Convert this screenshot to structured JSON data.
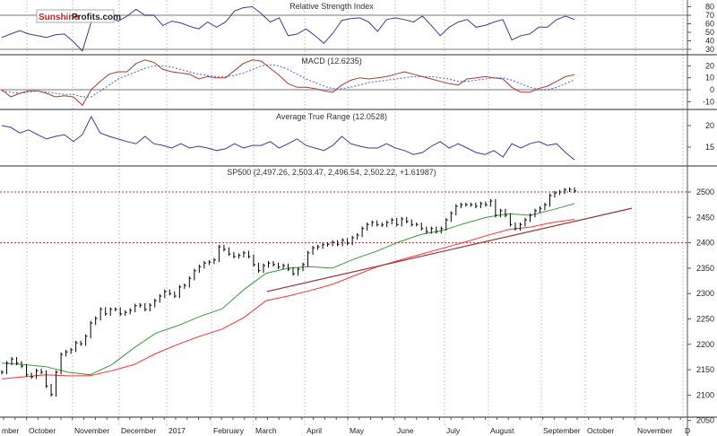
{
  "logo": {
    "part1": "Sunshine",
    "part2": "Profits.com"
  },
  "colors": {
    "rsi": "#3b3b9a",
    "macd": "#b03a2e",
    "signal": "#4a5cff",
    "atr": "#3b3b9a",
    "bars": "#000000",
    "ma_fast": "#3a9a3a",
    "ma_slow": "#ff3030",
    "trendline": "#a03030",
    "level_line": "#c03030"
  },
  "chart_data": [
    {
      "type": "line",
      "title": "Relative Strength Index",
      "ylim": [
        25,
        88
      ],
      "yticks": [
        "80",
        "70",
        "60",
        "50",
        "40",
        "30"
      ],
      "ytick_values": [
        80,
        70,
        60,
        50,
        40,
        30
      ],
      "reference_lines": [
        70,
        30
      ],
      "values": [
        44,
        48,
        52,
        48,
        46,
        44,
        47,
        48,
        39,
        28,
        62,
        63,
        68,
        63,
        69,
        77,
        70,
        70,
        58,
        63,
        61,
        57,
        54,
        62,
        56,
        62,
        75,
        79,
        80,
        72,
        62,
        67,
        46,
        48,
        54,
        46,
        37,
        49,
        64,
        66,
        67,
        62,
        51,
        65,
        67,
        65,
        62,
        69,
        58,
        46,
        56,
        62,
        65,
        56,
        58,
        62,
        65,
        41,
        46,
        48,
        56,
        56,
        65,
        69,
        65
      ]
    },
    {
      "type": "line",
      "title": "MACD (12.6235)",
      "ylim": [
        -16,
        28
      ],
      "yticks": [
        "20",
        "10",
        "0",
        "-10"
      ],
      "ytick_values": [
        20,
        10,
        0,
        -10
      ],
      "reference_lines": [
        0
      ],
      "series": [
        {
          "name": "MACD",
          "values": [
            0,
            -6,
            -3,
            -1,
            -1,
            -3,
            -6,
            -5,
            -6,
            -13,
            0,
            7,
            13,
            15,
            15,
            22,
            25,
            23,
            17,
            15,
            14,
            13,
            9,
            11,
            10,
            10,
            16,
            22,
            25,
            24,
            18,
            12,
            5,
            2,
            2,
            1,
            -1,
            -2,
            4,
            8,
            10,
            9,
            10,
            11,
            13,
            15,
            13,
            11,
            9,
            7,
            5,
            4,
            9,
            10,
            11,
            10,
            9,
            2,
            -2,
            -2,
            1,
            3,
            7,
            11,
            12.6
          ]
        },
        {
          "name": "Signal",
          "values": [
            -1,
            -2,
            -3,
            -2,
            -1,
            -2,
            -3,
            -4,
            -4,
            -6,
            -6,
            -1,
            4,
            9,
            12,
            15,
            18,
            20,
            20,
            19,
            17,
            15,
            13,
            12,
            11,
            11,
            12,
            14,
            17,
            20,
            21,
            20,
            17,
            13,
            9,
            6,
            3,
            1,
            1,
            2,
            4,
            6,
            7,
            8,
            9,
            10,
            11,
            11,
            11,
            10,
            9,
            7,
            7,
            8,
            9,
            10,
            10,
            8,
            5,
            2,
            0,
            0,
            2,
            5,
            8.5
          ]
        }
      ]
    },
    {
      "type": "line",
      "title": "Average True Range (12.0528)",
      "ylim": [
        11,
        24.5
      ],
      "yticks": [
        "20",
        "15"
      ],
      "ytick_values": [
        20,
        15
      ],
      "values": [
        20,
        19.6,
        18.3,
        19,
        17.9,
        16.9,
        17.5,
        17.9,
        16.3,
        17.9,
        22.1,
        18.3,
        17.5,
        16.9,
        16.3,
        15.8,
        17.5,
        15.8,
        15.4,
        14.8,
        15.8,
        14.8,
        15.2,
        14.8,
        14.2,
        14.6,
        15.8,
        14.8,
        15.4,
        15.4,
        16.3,
        14.8,
        15.8,
        16.9,
        15.4,
        14.8,
        14.2,
        15.4,
        17.5,
        15.8,
        15.2,
        14.8,
        14.8,
        15.8,
        14.8,
        14.2,
        13.3,
        13.75,
        15.2,
        16.3,
        14.8,
        15.8,
        14.8,
        13.75,
        13.3,
        14.2,
        12.7,
        15.8,
        14.8,
        15.8,
        16.3,
        15.4,
        15.8,
        13.75,
        12.05
      ]
    },
    {
      "type": "bar",
      "subtype": "ohlc",
      "title": "SP500 (2,497.26, 2,503.47, 2,496.54, 2,502.22, +1.61987)",
      "ylim": [
        2045,
        2550
      ],
      "yticks": [
        "2500",
        "2450",
        "2400",
        "2350",
        "2300",
        "2250",
        "2200",
        "2150",
        "2100",
        "2050"
      ],
      "ytick_values": [
        2500,
        2450,
        2400,
        2350,
        2300,
        2250,
        2200,
        2150,
        2100,
        2050
      ],
      "reference_lines": [
        2500,
        2400
      ],
      "closes": [
        2145,
        2163,
        2171,
        2163,
        2157,
        2140,
        2136,
        2148,
        2145,
        2118,
        2101,
        2145,
        2180,
        2185,
        2189,
        2203,
        2201,
        2216,
        2242,
        2251,
        2269,
        2260,
        2269,
        2269,
        2260,
        2263,
        2267,
        2276,
        2277,
        2269,
        2277,
        2286,
        2295,
        2304,
        2300,
        2295,
        2313,
        2316,
        2330,
        2345,
        2353,
        2360,
        2362,
        2366,
        2392,
        2387,
        2378,
        2373,
        2375,
        2380,
        2373,
        2357,
        2345,
        2355,
        2360,
        2357,
        2352,
        2355,
        2348,
        2339,
        2348,
        2357,
        2380,
        2390,
        2392,
        2396,
        2397,
        2401,
        2397,
        2405,
        2399,
        2410,
        2415,
        2428,
        2436,
        2440,
        2436,
        2435,
        2440,
        2445,
        2436,
        2447,
        2442,
        2436,
        2436,
        2428,
        2422,
        2428,
        2422,
        2428,
        2445,
        2458,
        2472,
        2475,
        2475,
        2475,
        2472,
        2477,
        2475,
        2482,
        2454,
        2463,
        2454,
        2436,
        2428,
        2436,
        2445,
        2454,
        2463,
        2468,
        2475,
        2493,
        2498,
        2500,
        2504,
        2505,
        2502
      ],
      "ma_fast": [
        2163,
        2160,
        2156,
        2145,
        2140,
        2160,
        2193,
        2222,
        2237,
        2255,
        2270,
        2308,
        2340,
        2350,
        2353,
        2350,
        2368,
        2383,
        2401,
        2416,
        2424,
        2438,
        2450,
        2457,
        2454,
        2465,
        2477
      ],
      "ma_slow": [
        2132,
        2136,
        2140,
        2138,
        2138,
        2148,
        2160,
        2182,
        2200,
        2216,
        2230,
        2253,
        2286,
        2295,
        2306,
        2318,
        2335,
        2352,
        2365,
        2377,
        2389,
        2401,
        2414,
        2426,
        2431,
        2440,
        2446
      ],
      "trendline": {
        "from": 2304,
        "to": 2468
      }
    }
  ],
  "x_axis": {
    "labels": [
      "mber",
      "October",
      "November",
      "December",
      "2017",
      "February",
      "March",
      "April",
      "May",
      "June",
      "July",
      "August",
      "September",
      "October",
      "November",
      "D"
    ]
  }
}
